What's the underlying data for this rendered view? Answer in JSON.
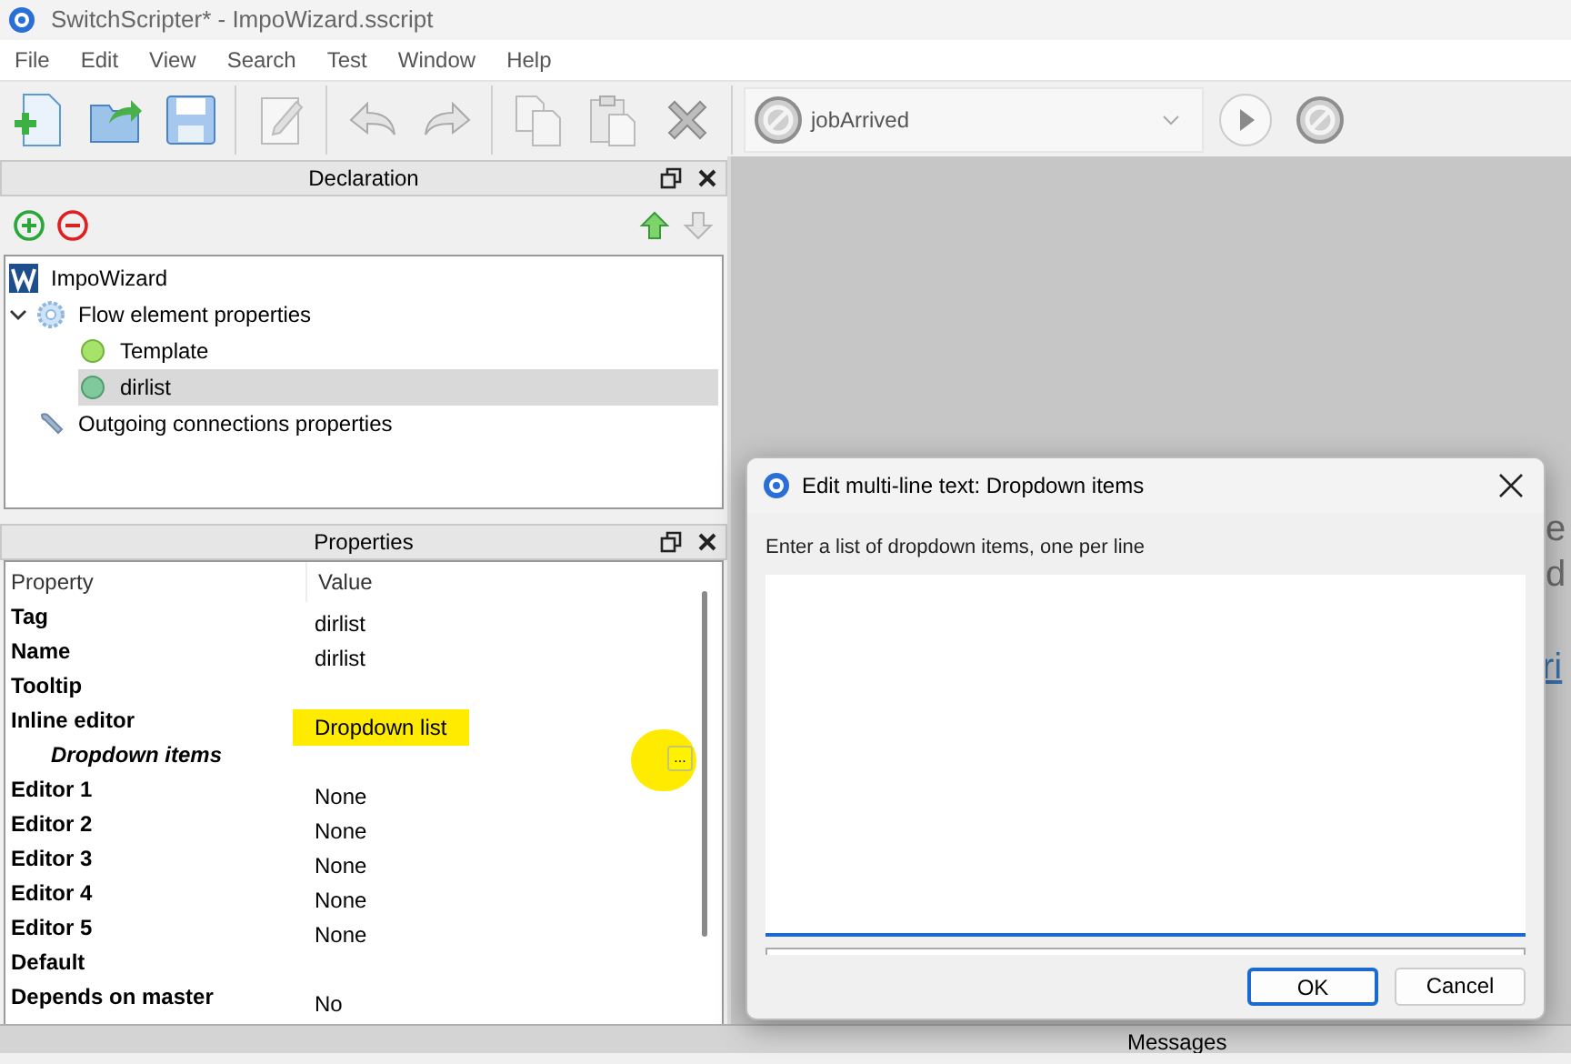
{
  "window": {
    "title": "SwitchScripter* - ImpoWizard.sscript"
  },
  "menu": [
    "File",
    "Edit",
    "View",
    "Search",
    "Test",
    "Window",
    "Help"
  ],
  "toolbar": {
    "entry_point": "jobArrived"
  },
  "declaration": {
    "title": "Declaration",
    "tree": [
      {
        "label": "ImpoWizard",
        "kind": "root",
        "selected": false
      },
      {
        "label": "Flow element properties",
        "kind": "gear",
        "selected": false,
        "expanded": true,
        "children": [
          {
            "label": "Template",
            "kind": "dot",
            "selected": false
          },
          {
            "label": "dirlist",
            "kind": "dot",
            "selected": true
          }
        ]
      },
      {
        "label": "Outgoing connections properties",
        "kind": "wrench",
        "selected": false
      }
    ]
  },
  "properties": {
    "title": "Properties",
    "columns": [
      "Property",
      "Value"
    ],
    "rows": [
      {
        "name": "Tag",
        "value": "dirlist",
        "kind": "plain"
      },
      {
        "name": "Name",
        "value": "dirlist",
        "kind": "plain"
      },
      {
        "name": "Tooltip",
        "kind": "plain"
      },
      {
        "name": "Inline editor",
        "value": "Dropdown list",
        "kind": "plain",
        "highlighted": true
      },
      {
        "name": "Dropdown items",
        "kind": "sub",
        "button": "...",
        "highlighted": true
      },
      {
        "name": "Editor 1",
        "value": "None",
        "kind": "plain"
      },
      {
        "name": "Editor 2",
        "value": "None",
        "kind": "plain"
      },
      {
        "name": "Editor 3",
        "value": "None",
        "kind": "plain"
      },
      {
        "name": "Editor 4",
        "value": "None",
        "kind": "plain"
      },
      {
        "name": "Editor 5",
        "value": "None",
        "kind": "plain"
      },
      {
        "name": "Default",
        "kind": "plain"
      },
      {
        "name": "Depends on master",
        "value": "No",
        "kind": "plain"
      }
    ]
  },
  "background_text": [
    "e",
    "d"
  ],
  "background_link": "ri",
  "dialog": {
    "title": "Edit multi-line text: Dropdown items",
    "prompt": "Enter a list of dropdown items, one per line",
    "buttons": [
      {
        "label": "OK",
        "default": true
      },
      {
        "label": "Cancel",
        "default": false
      }
    ]
  },
  "bottom_panel": {
    "title": "Messages"
  }
}
